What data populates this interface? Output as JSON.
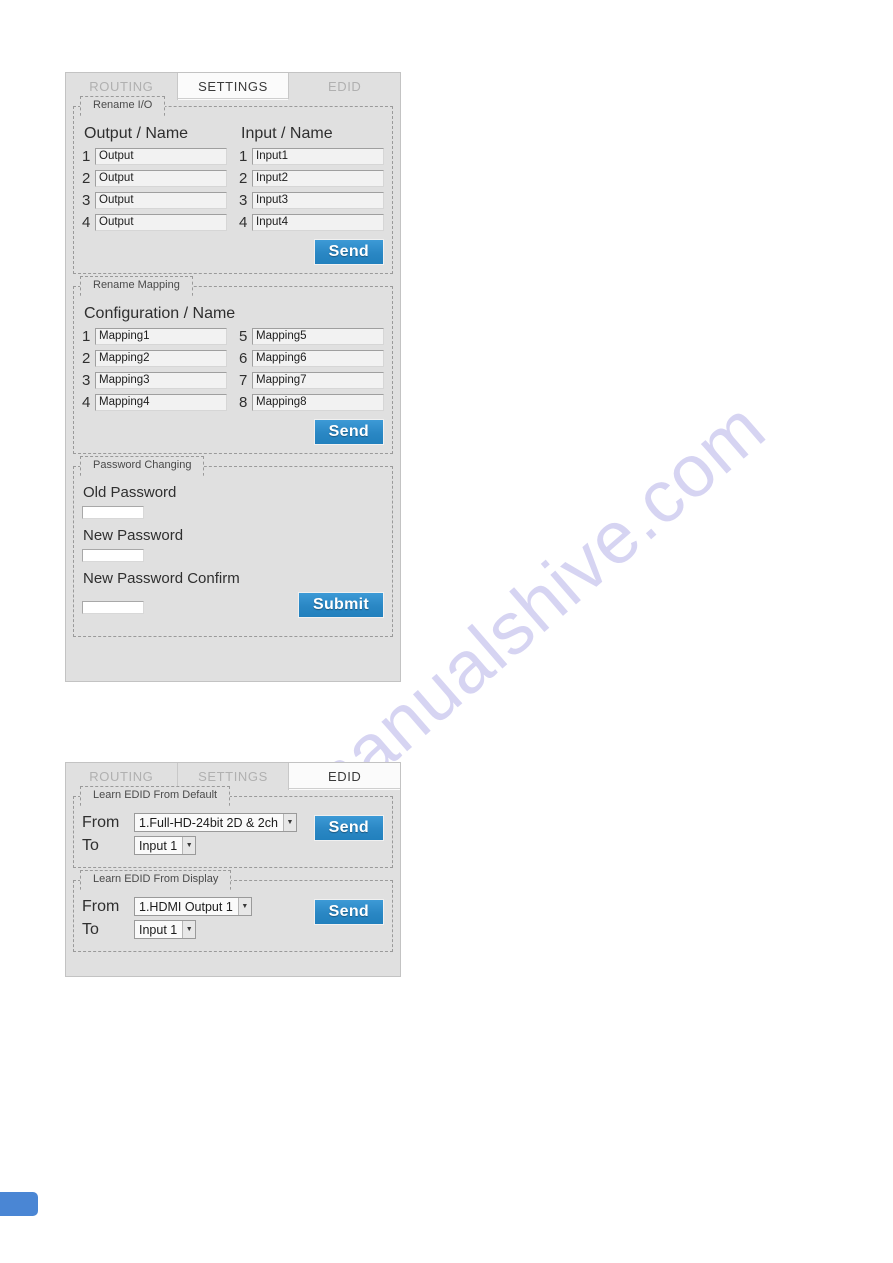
{
  "watermark": {
    "text": "manualshive.com"
  },
  "settings_window": {
    "tabs": [
      {
        "label": "ROUTING",
        "active": false
      },
      {
        "label": "SETTINGS",
        "active": true
      },
      {
        "label": "EDID",
        "active": false
      }
    ],
    "rename_io": {
      "legend": "Rename I/O",
      "output_heading": "Output / Name",
      "input_heading": "Input / Name",
      "outputs": [
        {
          "index": "1",
          "value": "Output"
        },
        {
          "index": "2",
          "value": "Output"
        },
        {
          "index": "3",
          "value": "Output"
        },
        {
          "index": "4",
          "value": "Output"
        }
      ],
      "inputs": [
        {
          "index": "1",
          "value": "Input1"
        },
        {
          "index": "2",
          "value": "Input2"
        },
        {
          "index": "3",
          "value": "Input3"
        },
        {
          "index": "4",
          "value": "Input4"
        }
      ],
      "send_label": "Send"
    },
    "rename_mapping": {
      "legend": "Rename Mapping",
      "heading": "Configuration / Name",
      "left": [
        {
          "index": "1",
          "value": "Mapping1"
        },
        {
          "index": "2",
          "value": "Mapping2"
        },
        {
          "index": "3",
          "value": "Mapping3"
        },
        {
          "index": "4",
          "value": "Mapping4"
        }
      ],
      "right": [
        {
          "index": "5",
          "value": "Mapping5"
        },
        {
          "index": "6",
          "value": "Mapping6"
        },
        {
          "index": "7",
          "value": "Mapping7"
        },
        {
          "index": "8",
          "value": "Mapping8"
        }
      ],
      "send_label": "Send"
    },
    "password_changing": {
      "legend": "Password Changing",
      "old_label": "Old Password",
      "old_value": "",
      "new_label": "New Password",
      "new_value": "",
      "confirm_label": "New Password Confirm",
      "confirm_value": "",
      "submit_label": "Submit"
    }
  },
  "edid_window": {
    "tabs": [
      {
        "label": "ROUTING",
        "active": false
      },
      {
        "label": "SETTINGS",
        "active": false
      },
      {
        "label": "EDID",
        "active": true
      }
    ],
    "learn_from_default": {
      "legend": "Learn EDID From Default",
      "from_label": "From",
      "from_value": "1.Full-HD-24bit 2D & 2ch",
      "to_label": "To",
      "to_value": "Input 1",
      "send_label": "Send"
    },
    "learn_from_display": {
      "legend": "Learn EDID From Display",
      "from_label": "From",
      "from_value": "1.HDMI Output 1",
      "to_label": "To",
      "to_value": "Input 1",
      "send_label": "Send"
    }
  },
  "colors": {
    "button_blue": "#2a87c4",
    "panel_gray": "#e0e0e0",
    "page_badge_blue": "#4a86d4"
  }
}
